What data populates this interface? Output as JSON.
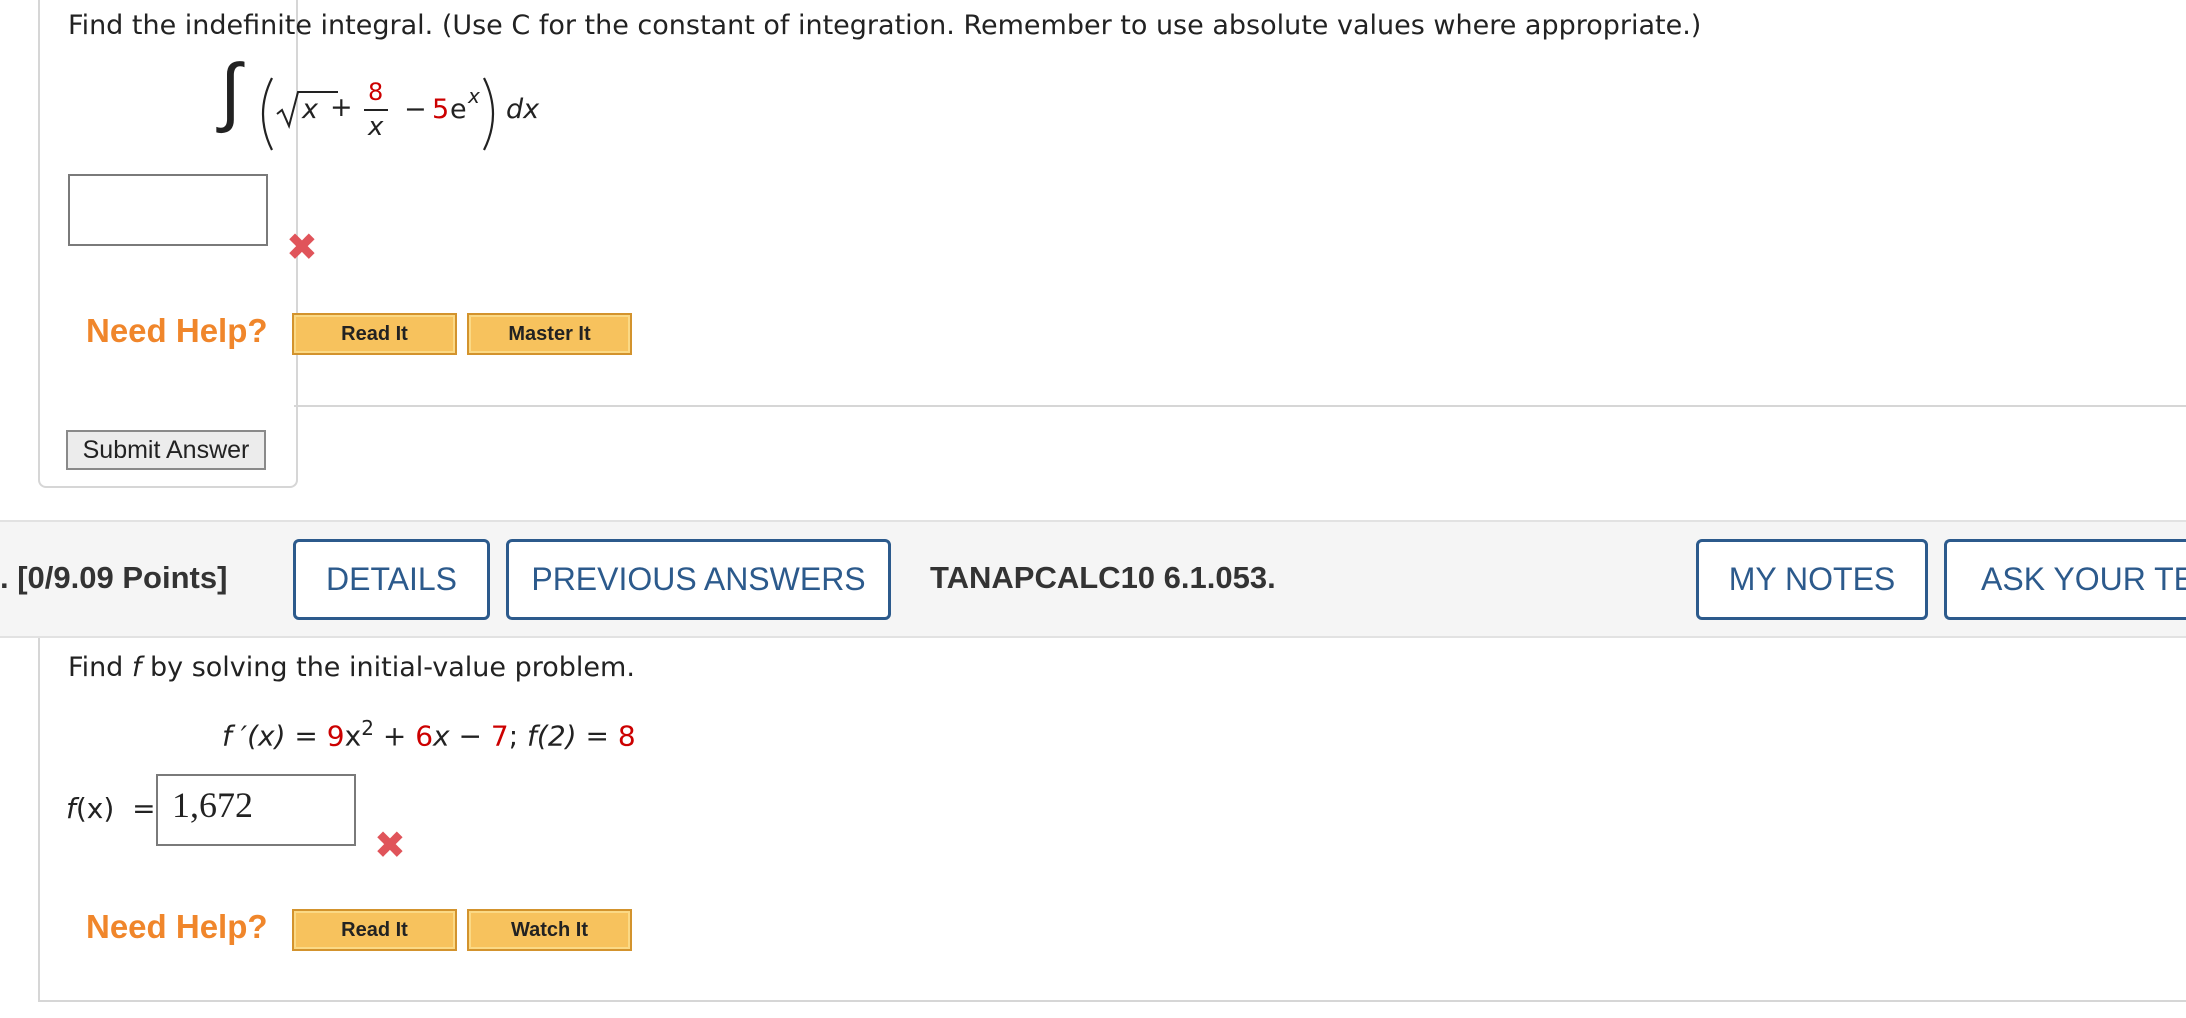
{
  "q1": {
    "prompt": "Find the indefinite integral. (Use C for the constant of integration. Remember to use absolute values where appropriate.)",
    "integral": {
      "integral_sign": "∫",
      "radicand": "x",
      "plus": "+",
      "frac_num": "8",
      "frac_den": "x",
      "minus": "−",
      "coef": "5",
      "base": "e",
      "exponent": "x",
      "differential": "dx"
    },
    "answer_value": "",
    "result_icon": "incorrect-x-icon",
    "need_help_label": "Need Help?",
    "help_buttons": [
      "Read It",
      "Master It"
    ],
    "submit_label": "Submit Answer"
  },
  "q2": {
    "header": {
      "points": ". [0/9.09 Points]",
      "details_label": "DETAILS",
      "previous_answers_label": "PREVIOUS ANSWERS",
      "problem_id": "TANAPCALC10 6.1.053.",
      "my_notes_label": "MY NOTES",
      "ask_teacher_label": "ASK YOUR TEA"
    },
    "prompt_before": "Find ",
    "prompt_var": "f",
    "prompt_after": " by solving the initial-value problem.",
    "equation": {
      "lhs": "f ′(x) = ",
      "c1": "9",
      "x1": "x",
      "exp": "2",
      "plus1": " + ",
      "c2": "6",
      "x2": "x",
      "minus": " − ",
      "c3": "7",
      "sep": "; ",
      "cond_lhs": "f(2) = ",
      "cond_val": "8"
    },
    "answer_label_f": "f",
    "answer_label_rest": "(x)  =",
    "answer_value": "1,672",
    "result_icon": "incorrect-x-icon",
    "need_help_label": "Need Help?",
    "help_buttons": [
      "Read It",
      "Watch It"
    ]
  },
  "colors": {
    "accent_red": "#cc0000",
    "help_orange": "#f0862b",
    "help_button": "#f7c25d",
    "nav_blue": "#2c5a8c",
    "error_x": "#e0545a"
  }
}
